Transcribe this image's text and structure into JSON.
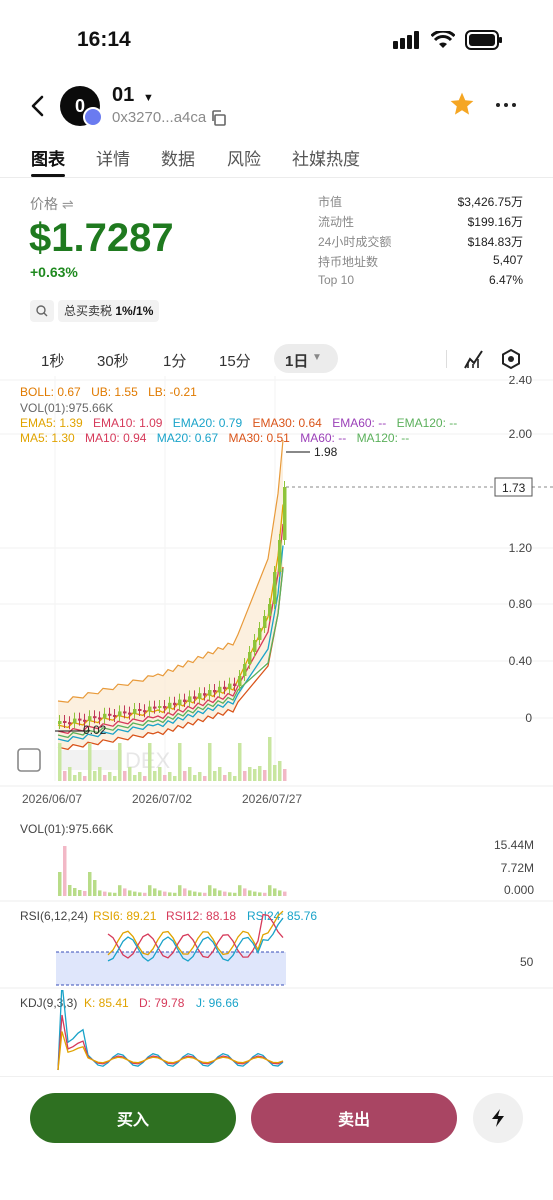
{
  "status": {
    "time": "16:14"
  },
  "header": {
    "avatar_letter": "0",
    "token_name": "01",
    "address": "0x3270...a4ca"
  },
  "tabs": [
    "图表",
    "详情",
    "数据",
    "风险",
    "社媒热度"
  ],
  "price": {
    "label": "价格",
    "value": "$1.7287",
    "change": "+0.63%"
  },
  "tax": {
    "label": "总买卖税",
    "value": "1%/1%"
  },
  "stats": [
    {
      "label": "市值",
      "value": "$3,426.75万"
    },
    {
      "label": "流动性",
      "value": "$199.16万"
    },
    {
      "label": "24小时成交额",
      "value": "$184.83万"
    },
    {
      "label": "持币地址数",
      "value": "5,407"
    },
    {
      "label": "Top 10",
      "value": "6.47%"
    }
  ],
  "intervals": [
    "1秒",
    "30秒",
    "1分",
    "15分",
    "1日"
  ],
  "main_legend": {
    "boll": "BOLL: 0.67",
    "ub": "UB: 1.55",
    "lb": "LB: -0.21",
    "vol": "VOL(01):975.66K",
    "ema": [
      "EMA5: 1.39",
      "EMA10: 1.09",
      "EMA20: 0.79",
      "EMA30: 0.64",
      "EMA60: --",
      "EMA120: --"
    ],
    "ma": [
      "MA5: 1.30",
      "MA10: 0.94",
      "MA20: 0.67",
      "MA30: 0.51",
      "MA60: --",
      "MA120: --"
    ]
  },
  "main_axis": {
    "ticks": [
      "2.40",
      "2.00",
      "1.20",
      "0.80",
      "0.40",
      "0"
    ],
    "dates": [
      "2026/06/07",
      "2026/07/02",
      "2026/07/27"
    ],
    "current": "1.73",
    "high_label": "1.98",
    "low_label": "0.02",
    "watermark": "DEX"
  },
  "vol_panel": {
    "legend": "VOL(01):975.66K",
    "ticks": [
      "15.44M",
      "7.72M",
      "0.000"
    ]
  },
  "rsi_panel": {
    "title": "RSI(6,12,24)",
    "rsi6": "RSI6: 89.21",
    "rsi12": "RSI12: 88.18",
    "rsi24": "RSI24: 85.76",
    "tick": "50"
  },
  "kdj_panel": {
    "title": "KDJ(9,3,3)",
    "k": "K: 85.41",
    "d": "D: 79.78",
    "j": "J: 96.66"
  },
  "actions": {
    "buy": "买入",
    "sell": "卖出"
  },
  "colors": {
    "up": "#1f7a1f",
    "down": "#c0395b",
    "buy": "#2e7021",
    "sell": "#a94563",
    "star": "#f5a623"
  }
}
